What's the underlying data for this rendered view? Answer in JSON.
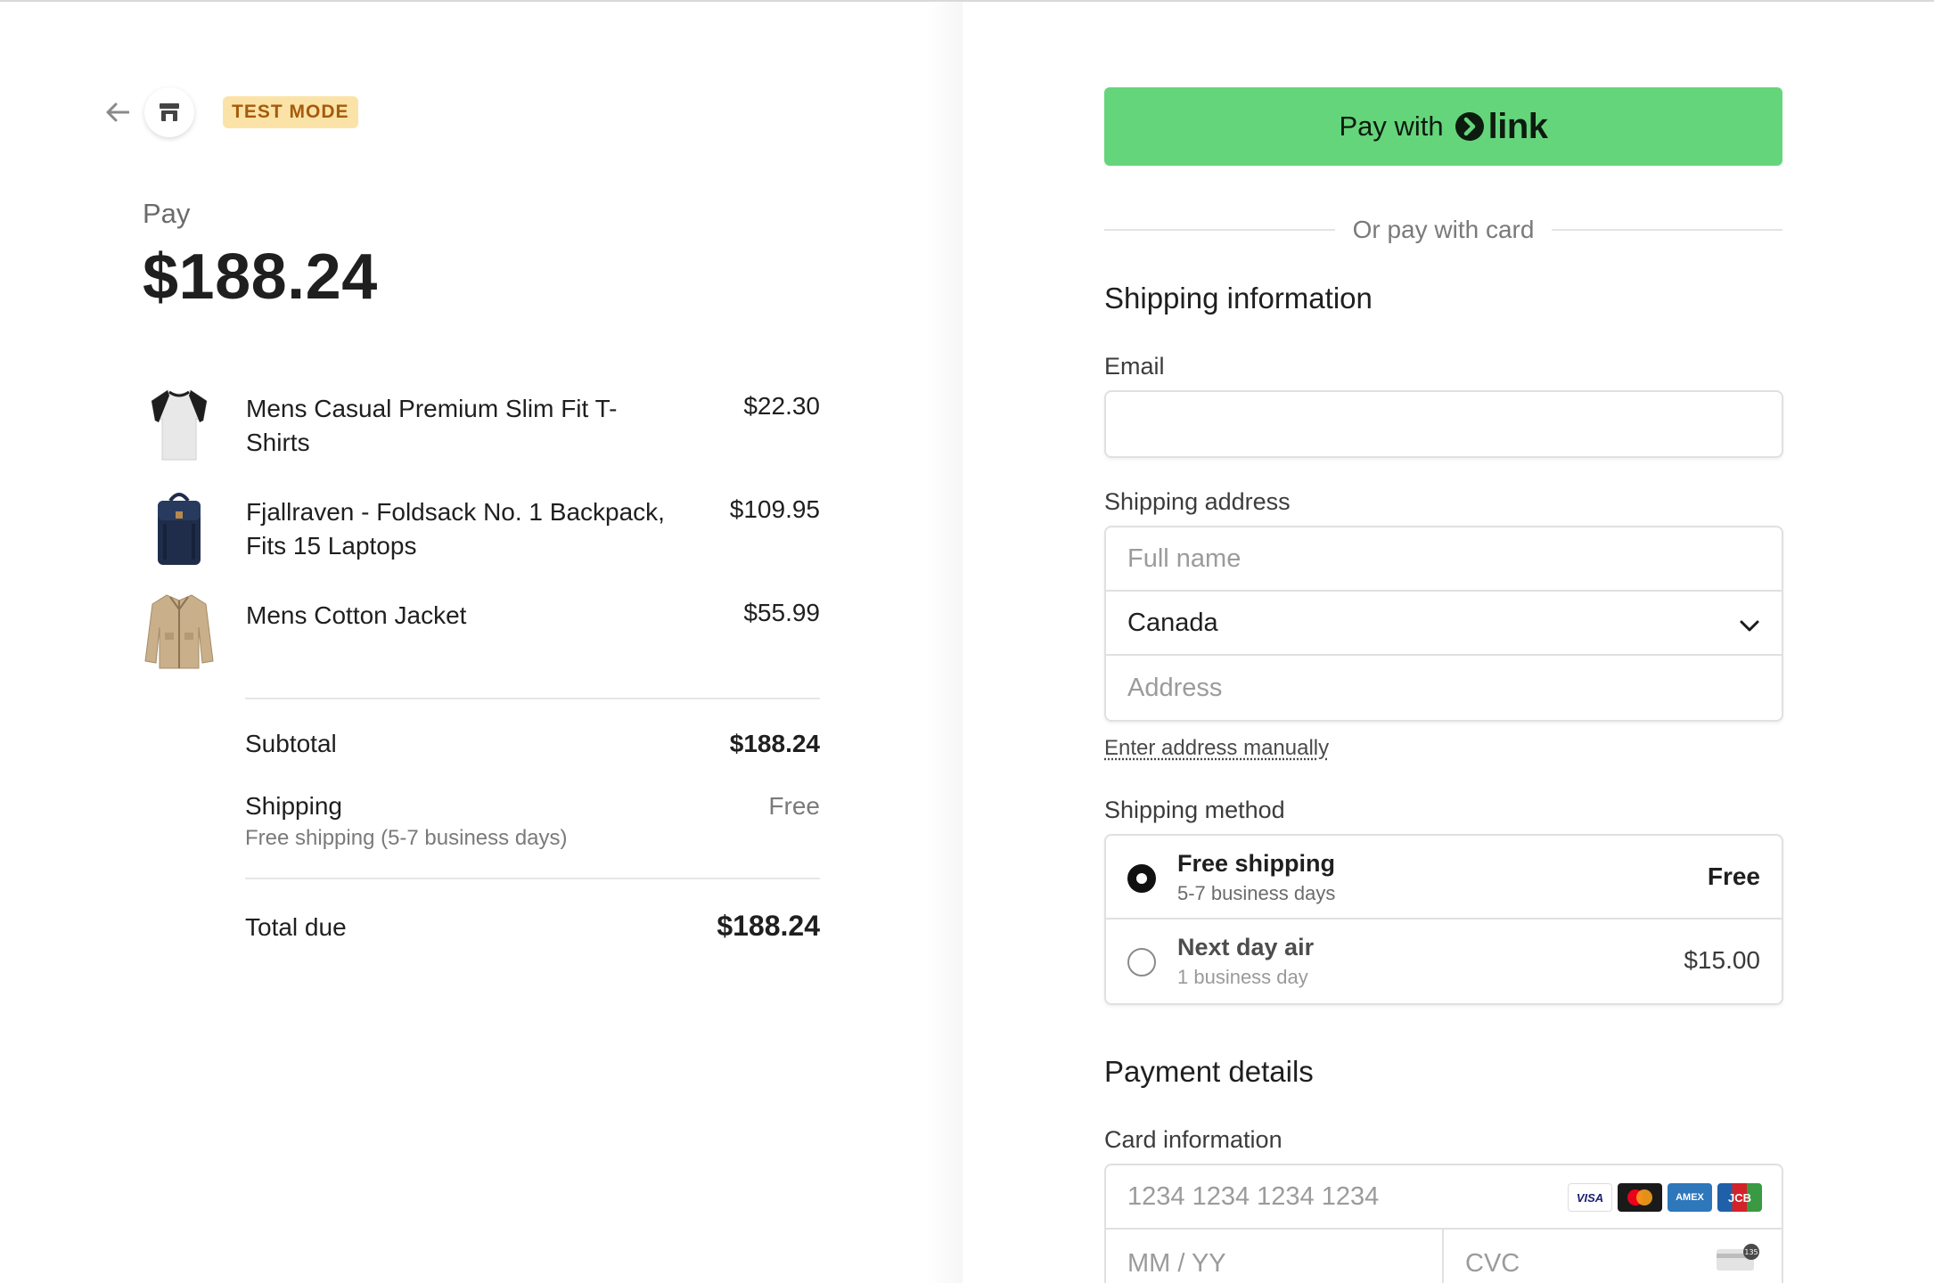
{
  "header": {
    "back_icon": "arrow-left-icon",
    "store_icon": "store-icon",
    "badge": "TEST MODE"
  },
  "summary": {
    "pay_label": "Pay",
    "amount": "$188.24",
    "items": [
      {
        "name": "Mens Casual Premium Slim Fit T-Shirts",
        "price": "$22.30",
        "thumb": "tshirt-thumbnail"
      },
      {
        "name": "Fjallraven - Foldsack No. 1 Backpack, Fits 15 Laptops",
        "price": "$109.95",
        "thumb": "backpack-thumbnail"
      },
      {
        "name": "Mens Cotton Jacket",
        "price": "$55.99",
        "thumb": "jacket-thumbnail"
      }
    ],
    "subtotal_label": "Subtotal",
    "subtotal_value": "$188.24",
    "shipping_label": "Shipping",
    "shipping_value": "Free",
    "shipping_sub": "Free shipping (5-7 business days)",
    "total_label": "Total due",
    "total_value": "$188.24"
  },
  "checkout": {
    "link_button_prefix": "Pay with",
    "link_button_brand": "link",
    "or_text": "Or pay with card",
    "shipping_heading": "Shipping information",
    "email_label": "Email",
    "email_value": "",
    "address_label": "Shipping address",
    "fullname_placeholder": "Full name",
    "country_value": "Canada",
    "address_placeholder": "Address",
    "enter_manually": "Enter address manually",
    "method_label": "Shipping method",
    "methods": [
      {
        "title": "Free shipping",
        "desc": "5-7 business days",
        "price": "Free",
        "selected": true
      },
      {
        "title": "Next day air",
        "desc": "1 business day",
        "price": "$15.00",
        "selected": false
      }
    ],
    "payment_heading": "Payment details",
    "card_label": "Card information",
    "card_number_placeholder": "1234 1234 1234 1234",
    "card_brands": [
      "VISA",
      "mastercard",
      "AMEX",
      "JCB"
    ],
    "expiry_placeholder": "MM / YY",
    "cvc_placeholder": "CVC"
  },
  "colors": {
    "link_green": "#65d57b",
    "badge_bg": "#fbe3a8",
    "badge_text": "#a55b0b"
  }
}
